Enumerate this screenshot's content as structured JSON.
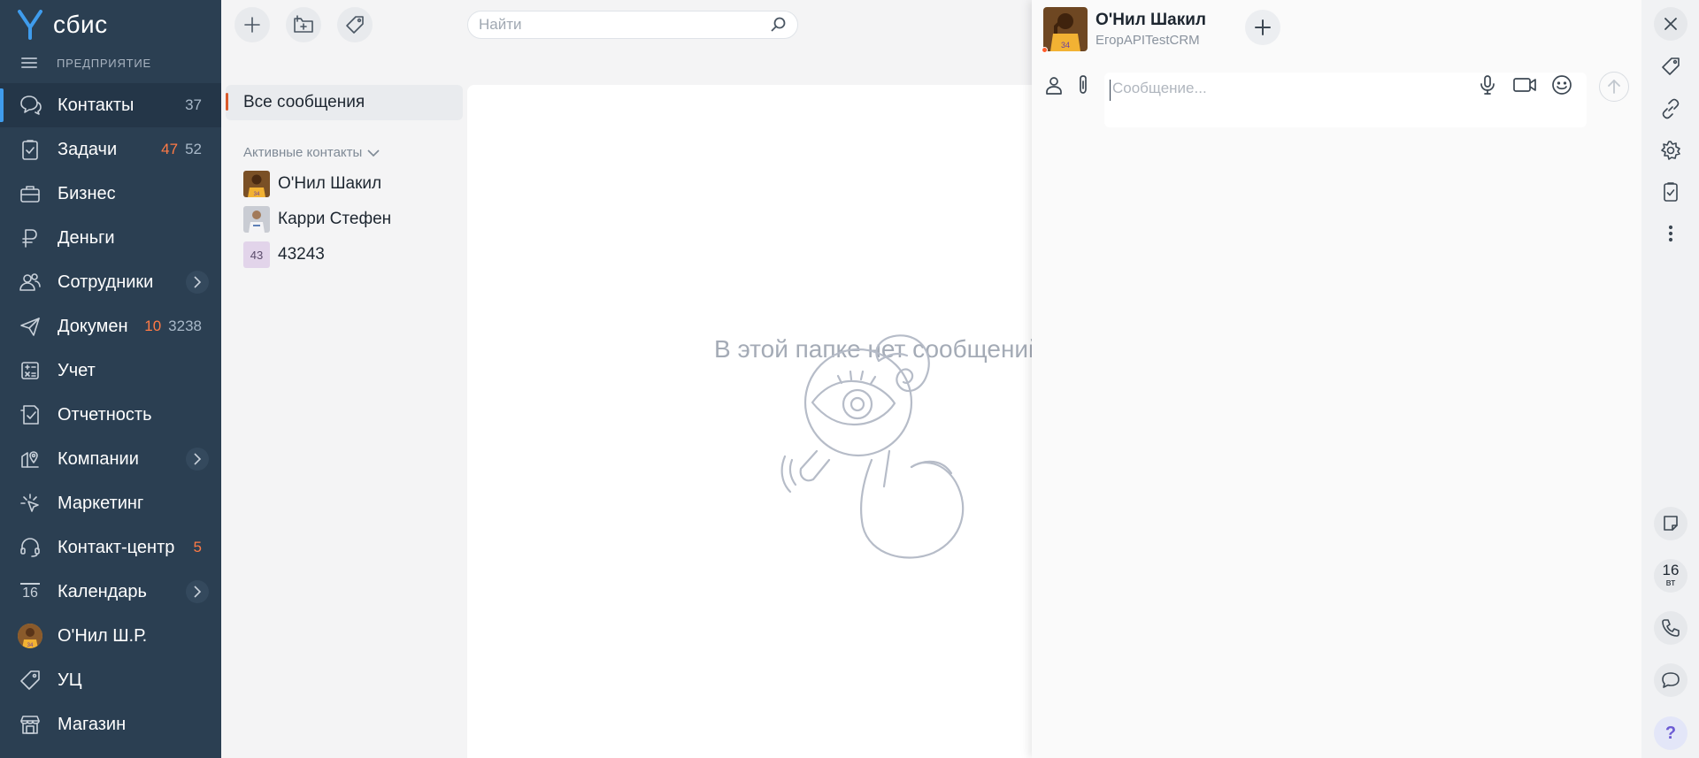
{
  "app": {
    "logo_text": "сбис",
    "org_name": "ПРЕДПРИЯТИЕ"
  },
  "nav": {
    "items": [
      {
        "label": "Контакты",
        "icon": "chat-bubbles-icon",
        "counters": [
          "37"
        ],
        "active": true
      },
      {
        "label": "Задачи",
        "icon": "tasks-icon",
        "counters": [
          "47",
          "52"
        ]
      },
      {
        "label": "Бизнес",
        "icon": "briefcase-icon"
      },
      {
        "label": "Деньги",
        "icon": "ruble-icon"
      },
      {
        "label": "Сотрудники",
        "icon": "people-icon",
        "expandable": true
      },
      {
        "label": "Документы",
        "icon": "paper-plane-icon",
        "counters": [
          "10",
          "3238"
        ]
      },
      {
        "label": "Учет",
        "icon": "calculator-icon"
      },
      {
        "label": "Отчетность",
        "icon": "report-icon"
      },
      {
        "label": "Компании",
        "icon": "company-pin-icon",
        "expandable": true
      },
      {
        "label": "Маркетинг",
        "icon": "cursor-click-icon"
      },
      {
        "label": "Контакт-центр",
        "icon": "headset-icon",
        "counters": [
          "5"
        ]
      },
      {
        "label": "Календарь",
        "icon": "calendar-icon",
        "icon_text": "16",
        "expandable": true
      },
      {
        "label": "О'Нил Ш.Р.",
        "icon": "user-avatar"
      },
      {
        "label": "УЦ",
        "icon": "tag-icon"
      },
      {
        "label": "Магазин",
        "icon": "store-icon"
      }
    ]
  },
  "search": {
    "placeholder": "Найти"
  },
  "folders": {
    "all_label": "Все сообщения",
    "contacts_header": "Активные контакты",
    "contacts": [
      {
        "name": "О'Нил Шакил",
        "avatar": "photo"
      },
      {
        "name": "Карри Стефен",
        "avatar": "photo"
      },
      {
        "name": "43243",
        "avatar_initials": "43"
      }
    ]
  },
  "messages": {
    "empty_text": "В этой папке нет сообщений"
  },
  "chat": {
    "name": "О'Нил Шакил",
    "subtitle": "ЕгорAPITestCRM",
    "message_placeholder": "Сообщение..."
  },
  "rail": {
    "date_number": "16",
    "date_day": "вт",
    "help_label": "?"
  },
  "colors": {
    "sidebar_bg": "#2b3f52",
    "accent_counter": "#ff7a45",
    "active_marker": "#3f9ced",
    "folder_marker": "#d95a2b"
  }
}
